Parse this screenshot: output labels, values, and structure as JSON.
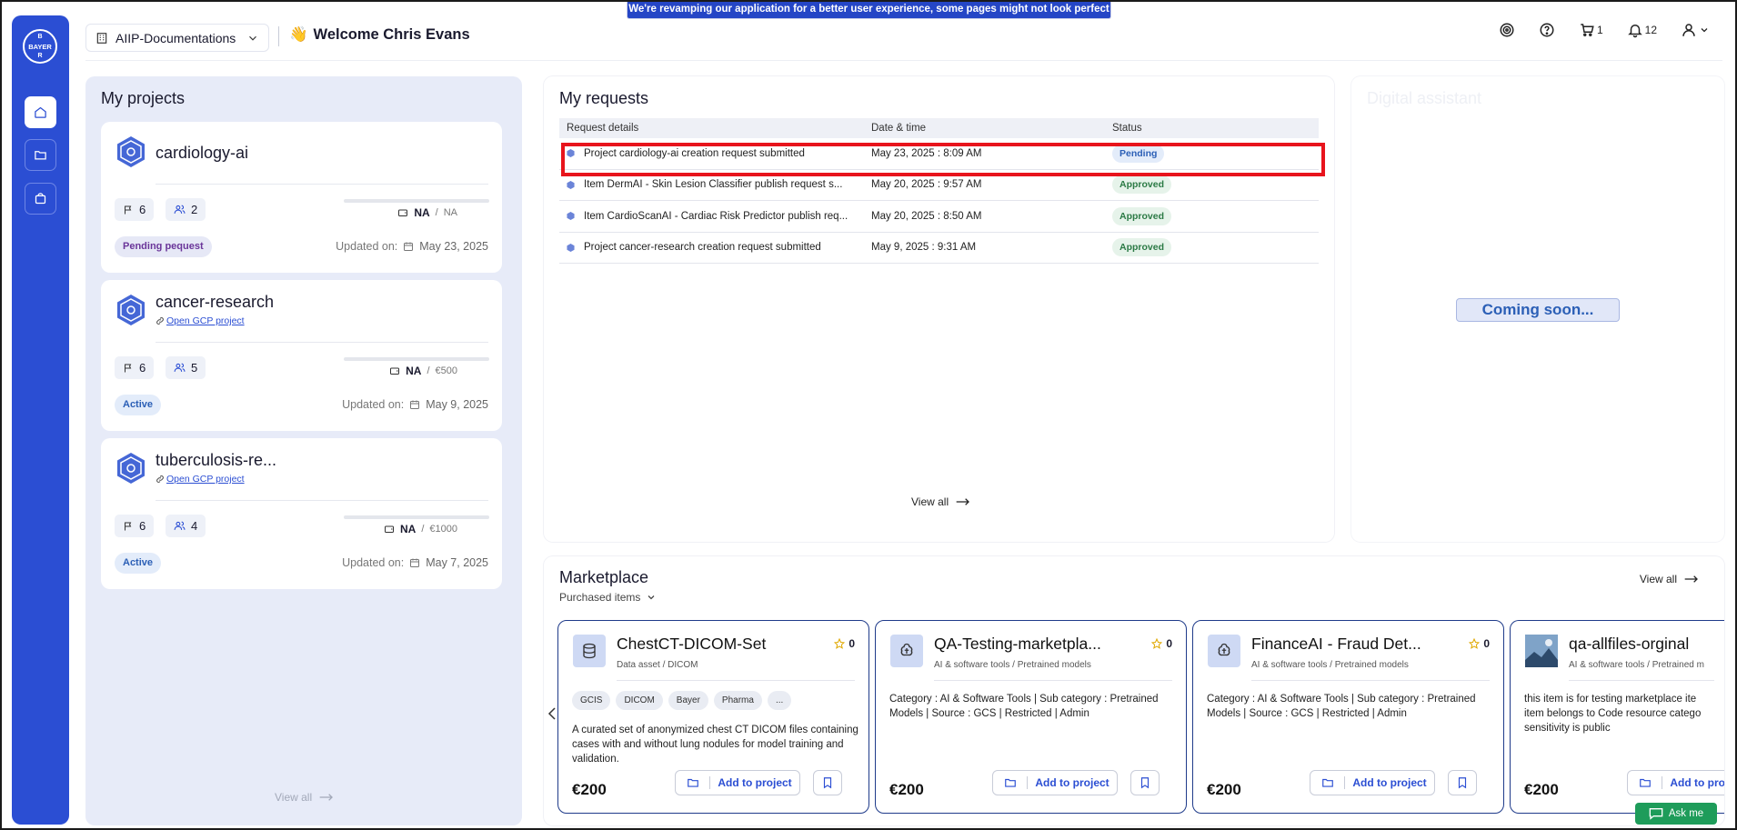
{
  "banner": "We're revamping our application for a better user experience, some pages might not look perfect yet!",
  "sidebar": {
    "logo_text": "BAYER",
    "items": [
      {
        "icon": "home-icon",
        "active": true
      },
      {
        "icon": "folder-icon",
        "active": false
      },
      {
        "icon": "bag-icon",
        "active": false
      }
    ]
  },
  "header": {
    "project_select": "AIIP-Documentations",
    "welcome_emoji": "👋",
    "welcome": "Welcome Chris Evans",
    "cart_count": "1",
    "notification_count": "12"
  },
  "projects": {
    "title": "My projects",
    "view_all": "View all",
    "items": [
      {
        "name": "cardiology-ai",
        "link": "",
        "flags": "6",
        "members": "2",
        "budget_na": "NA",
        "budget_amount": "NA",
        "status": "Pending pequest",
        "updated_label": "Updated on:",
        "updated_date": "May 23, 2025"
      },
      {
        "name": "cancer-research",
        "link": "Open GCP project",
        "flags": "6",
        "members": "5",
        "budget_na": "NA",
        "budget_amount": "€500",
        "status": "Active",
        "updated_label": "Updated on:",
        "updated_date": "May 9, 2025"
      },
      {
        "name": "tuberculosis-re...",
        "link": "Open GCP project",
        "flags": "6",
        "members": "4",
        "budget_na": "NA",
        "budget_amount": "€1000",
        "status": "Active",
        "updated_label": "Updated on:",
        "updated_date": "May 7, 2025"
      }
    ]
  },
  "requests": {
    "title": "My requests",
    "columns": [
      "Request details",
      "Date & time",
      "Status"
    ],
    "rows": [
      {
        "details": "Project cardiology-ai creation request submitted",
        "date": "May 23, 2025 : 8:09 AM",
        "status": "Pending"
      },
      {
        "details": "Item DermAI - Skin Lesion Classifier publish request s...",
        "date": "May 20, 2025 : 9:57 AM",
        "status": "Approved"
      },
      {
        "details": "Item CardioScanAI - Cardiac Risk Predictor publish req...",
        "date": "May 20, 2025 : 8:50 AM",
        "status": "Approved"
      },
      {
        "details": "Project cancer-research creation request submitted",
        "date": "May 9, 2025 : 9:31 AM",
        "status": "Approved"
      }
    ],
    "view_all": "View all"
  },
  "assistant": {
    "title": "Digital assistant",
    "coming_soon": "Coming soon..."
  },
  "marketplace": {
    "title": "Marketplace",
    "filter": "Purchased items",
    "view_all": "View all",
    "add_label": "Add to project",
    "cards": [
      {
        "name": "ChestCT-DICOM-Set",
        "rating": "0",
        "category": "Data asset / DICOM",
        "tags": [
          "GCIS",
          "DICOM",
          "Bayer",
          "Pharma",
          "..."
        ],
        "desc": "A curated set of anonymized chest CT DICOM files containing cases with and without lung nodules for model training and validation.",
        "price": "€200",
        "icon": "database-icon"
      },
      {
        "name": "QA-Testing-marketpla...",
        "rating": "0",
        "category": "AI & software tools / Pretrained models",
        "tags": [],
        "desc": "Category : AI & Software Tools | Sub category : Pretrained Models | Source : GCS | Restricted | Admin",
        "price": "€200",
        "icon": "ai-brain-icon"
      },
      {
        "name": "FinanceAI - Fraud Det...",
        "rating": "0",
        "category": "AI & software tools / Pretrained models",
        "tags": [],
        "desc": "Category : AI & Software Tools | Sub category : Pretrained Models | Source : GCS | Restricted | Admin",
        "price": "€200",
        "icon": "ai-brain-icon"
      },
      {
        "name": "qa-allfiles-orginal",
        "rating": "",
        "category": "AI & software tools / Pretrained m",
        "tags": [],
        "desc": "this item is for testing marketplace ite item belongs to Code resource catego sensitivity is public",
        "price": "€200",
        "icon": "thumbnail-image"
      }
    ]
  },
  "ask_me": "Ask me",
  "colors": {
    "primary": "#2b4ed3",
    "highlight": "#e8141c",
    "approved": "#2b7a45",
    "ask": "#1e9c5a"
  }
}
